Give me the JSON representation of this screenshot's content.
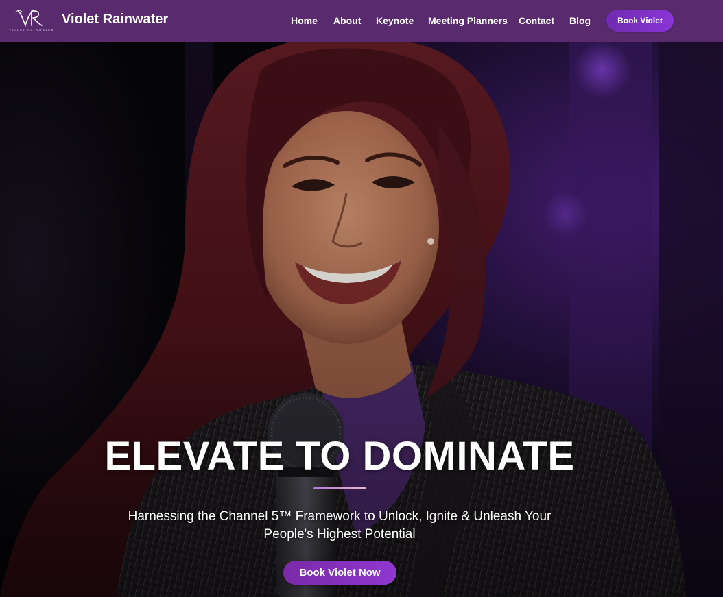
{
  "header": {
    "logo_monogram": "VR",
    "logo_tagline": "VIOLET RAINWATER",
    "site_name": "Violet Rainwater",
    "nav": [
      {
        "label": "Home"
      },
      {
        "label": "About"
      },
      {
        "label": "Keynote"
      },
      {
        "label": "Meeting Planners"
      },
      {
        "label": "Contact"
      },
      {
        "label": "Blog"
      }
    ],
    "cta_label": "Book Violet"
  },
  "hero": {
    "headline": "ELEVATE TO DOMINATE",
    "subtitle": "Harnessing the Channel 5™ Framework to Unlock, Ignite & Unleash Your People's Highest Potential",
    "cta_label": "Book Violet Now"
  },
  "colors": {
    "header_bg": "#5a2a6e",
    "accent": "#8a35d6",
    "text": "#ffffff"
  }
}
